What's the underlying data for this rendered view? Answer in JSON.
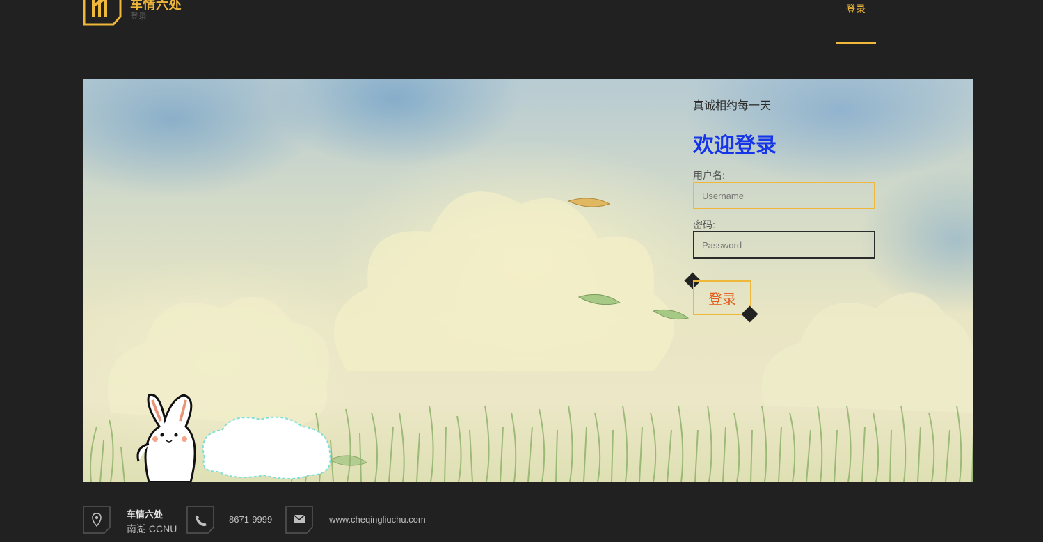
{
  "header": {
    "brand_title": "车情六处",
    "brand_subtitle": "登录",
    "nav_login": "登录"
  },
  "hero": {
    "tagline": "真诚相约每一天",
    "welcome_title": "欢迎登录",
    "username_label": "用户名:",
    "username_placeholder": "Username",
    "username_value": "",
    "password_label": "密码:",
    "password_placeholder": "Password",
    "password_value": "",
    "login_button": "登录"
  },
  "footer": {
    "org_name": "车情六处",
    "address": "南湖 CCNU",
    "phone": "8671-9999",
    "website": "www.cheqingliuchu.com",
    "icons": [
      "location-pin-icon",
      "phone-icon",
      "mail-icon"
    ]
  },
  "colors": {
    "background": "#212121",
    "accent": "#f0b83a",
    "welcome_blue": "#1735e8",
    "button_text": "#e25a18"
  }
}
